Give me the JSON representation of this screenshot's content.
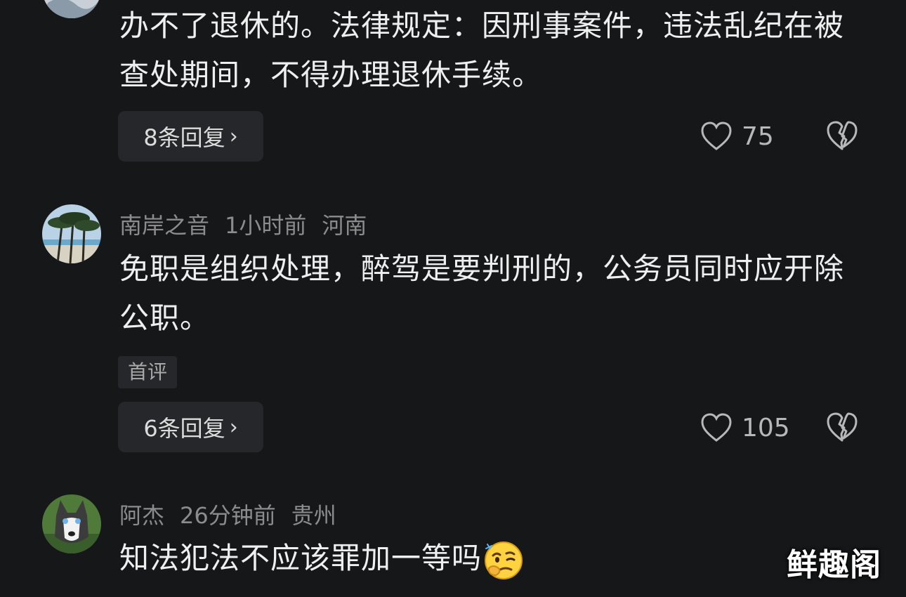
{
  "comments": [
    {
      "text": "办不了退休的。法律规定：因刑事案件，违法乱纪在被查处期间，不得办理退休手续。",
      "reply_label": "8条回复",
      "likes": "75"
    },
    {
      "username": "南岸之音",
      "time": "1小时前",
      "location": "河南",
      "text": "免职是组织处理，醉驾是要判刑的，公务员同时应开除公职。",
      "tag": "首评",
      "reply_label": "6条回复",
      "likes": "105"
    },
    {
      "username": "阿杰",
      "time": "26分钟前",
      "location": "贵州",
      "text": "知法犯法不应该罪加一等吗"
    }
  ],
  "watermark": "鲜趣阁",
  "icons": {
    "like": "heart-outline-icon",
    "dislike": "broken-heart-icon",
    "reply_chevron": "chevron-right-icon",
    "emoji": "thinking-face-emoji"
  }
}
